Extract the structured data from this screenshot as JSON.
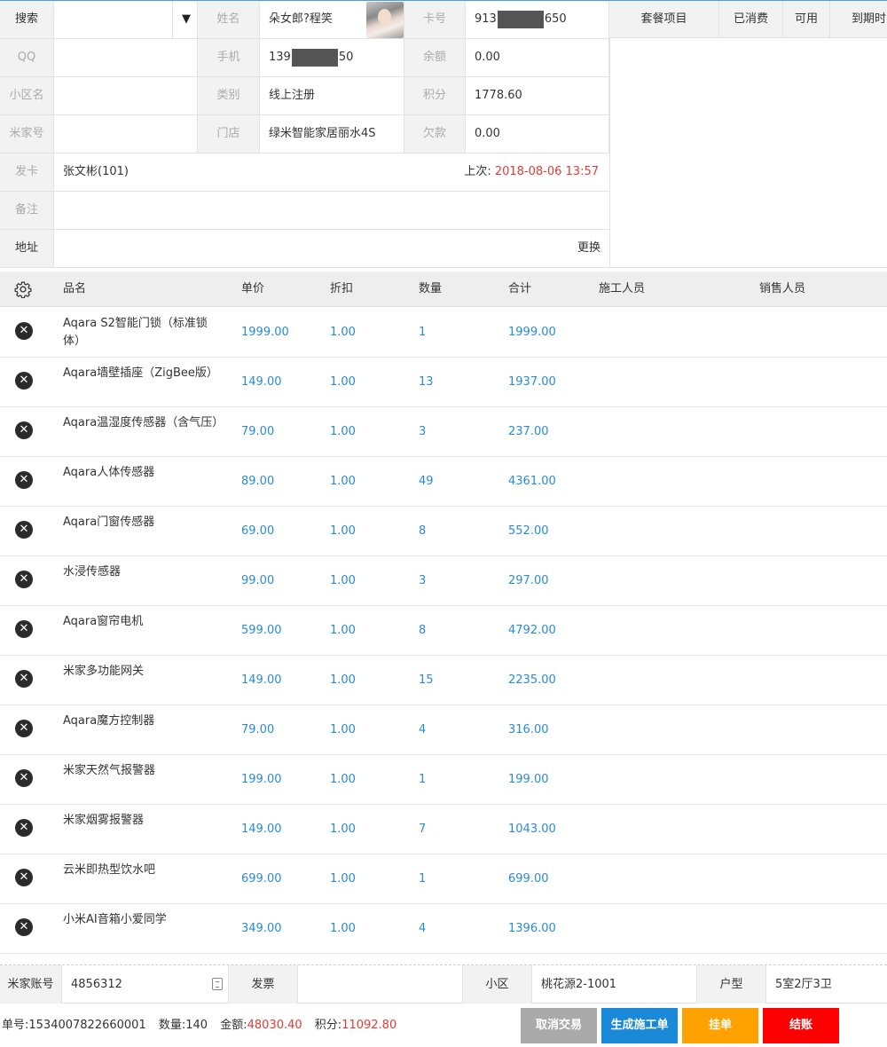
{
  "member": {
    "search_label": "搜索",
    "search_value": "",
    "qq_label": "QQ",
    "qq_value": "",
    "community_label": "小区名",
    "community_value": "",
    "mijia_label": "米家号",
    "mijia_value": "",
    "issuer_label": "发卡",
    "issuer_value": "张文彬(101)",
    "last_label": "上次:",
    "last_time": "2018-08-06 13:57",
    "note_label": "备注",
    "note_value": "",
    "address_label": "地址",
    "address_value": "",
    "change_label": "更换",
    "name_label": "姓名",
    "name_value": "朵女郎?程笑",
    "phone_label": "手机",
    "phone_prefix": "139",
    "phone_suffix": "50",
    "type_label": "类别",
    "type_value": "线上注册",
    "store_label": "门店",
    "store_value": "绿米智能家居丽水4S",
    "card_label": "卡号",
    "card_prefix": "913",
    "card_suffix": "650",
    "balance_label": "余额",
    "balance_value": "0.00",
    "points_label": "积分",
    "points_value": "1778.60",
    "debt_label": "欠款",
    "debt_value": "0.00"
  },
  "package": {
    "headers": [
      "套餐项目",
      "已消费",
      "可用",
      "到期时"
    ]
  },
  "table": {
    "headers": [
      "品名",
      "单价",
      "折扣",
      "数量",
      "合计",
      "施工人员",
      "销售人员"
    ],
    "rows": [
      {
        "name": "Aqara S2智能门锁（标准锁体）",
        "price": "1999.00",
        "discount": "1.00",
        "qty": "1",
        "total": "1999.00"
      },
      {
        "name": "Aqara墙壁插座（ZigBee版）",
        "price": "149.00",
        "discount": "1.00",
        "qty": "13",
        "total": "1937.00"
      },
      {
        "name": "Aqara温湿度传感器（含气压）",
        "price": "79.00",
        "discount": "1.00",
        "qty": "3",
        "total": "237.00"
      },
      {
        "name": "Aqara人体传感器",
        "price": "89.00",
        "discount": "1.00",
        "qty": "49",
        "total": "4361.00"
      },
      {
        "name": "Aqara门窗传感器",
        "price": "69.00",
        "discount": "1.00",
        "qty": "8",
        "total": "552.00"
      },
      {
        "name": "水浸传感器",
        "price": "99.00",
        "discount": "1.00",
        "qty": "3",
        "total": "297.00"
      },
      {
        "name": "Aqara窗帘电机",
        "price": "599.00",
        "discount": "1.00",
        "qty": "8",
        "total": "4792.00"
      },
      {
        "name": "米家多功能网关",
        "price": "149.00",
        "discount": "1.00",
        "qty": "15",
        "total": "2235.00"
      },
      {
        "name": "Aqara魔方控制器",
        "price": "79.00",
        "discount": "1.00",
        "qty": "4",
        "total": "316.00"
      },
      {
        "name": "米家天然气报警器",
        "price": "199.00",
        "discount": "1.00",
        "qty": "1",
        "total": "199.00"
      },
      {
        "name": "米家烟雾报警器",
        "price": "149.00",
        "discount": "1.00",
        "qty": "7",
        "total": "1043.00"
      },
      {
        "name": "云米即热型饮水吧",
        "price": "699.00",
        "discount": "1.00",
        "qty": "1",
        "total": "699.00"
      },
      {
        "name": "小米AI音箱小爱同学",
        "price": "349.00",
        "discount": "1.00",
        "qty": "4",
        "total": "1396.00"
      }
    ]
  },
  "bottom": {
    "mijia_account_label": "米家账号",
    "mijia_account_value": "4856312",
    "invoice_label": "发票",
    "invoice_value": "",
    "community_label": "小区",
    "community_value": "桃花源2-1001",
    "layout_label": "户型",
    "layout_value": "5室2厅3卫"
  },
  "summary": {
    "order_label": "单号:",
    "order_value": "1534007822660001",
    "qty_label": "数量:",
    "qty_value": "140",
    "amount_label": "金额:",
    "amount_value": "48030.40",
    "points_label": "积分:",
    "points_value": "11092.80"
  },
  "actions": {
    "cancel": "取消交易",
    "work_order": "生成施工单",
    "hold": "挂单",
    "checkout": "结账"
  },
  "icons": {
    "settings": "gear-icon",
    "delete": "close-circle-icon",
    "dropdown": "caret-down-icon",
    "card_reader": "card-icon"
  },
  "colors": {
    "accent_blue": "#1a8ad8",
    "value_blue": "#2a8bd4",
    "red": "#e53935",
    "cancel_gray": "#aaaaaa",
    "hold_orange": "#ffa200",
    "checkout_red": "#ff0000"
  }
}
